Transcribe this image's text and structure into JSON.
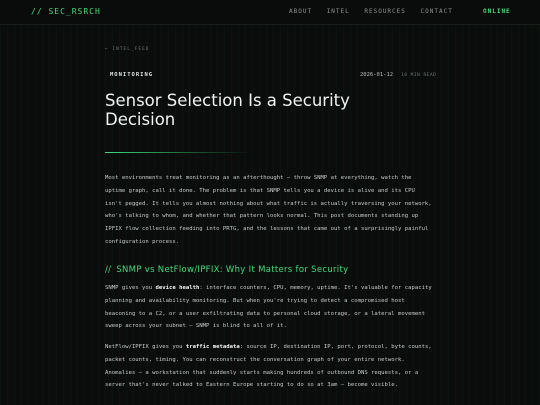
{
  "header": {
    "brand": "// SEC_RSRCH",
    "nav": [
      "ABOUT",
      "INTEL",
      "RESOURCES",
      "CONTACT"
    ],
    "status": "ONLINE"
  },
  "article": {
    "breadcrumb": "← INTEL_FEED",
    "category": "MONITORING",
    "date": "2026-01-12",
    "read_time": "10 MIN READ",
    "title": "Sensor Selection Is a Security Decision",
    "intro": "Most environments treat monitoring as an afterthought — throw SNMP at everything, watch the uptime graph, call it done. The problem is that SNMP tells you a device is alive and its CPU isn't pegged. It tells you almost nothing about what traffic is actually traversing your network, who's talking to whom, and whether that pattern looks normal. This post documents standing up IPFIX flow collection feeding into PRTG, and the lessons that came out of a surprisingly painful configuration process.",
    "section_heading_prefix": "//",
    "section_heading": "SNMP vs NetFlow/IPFIX: Why It Matters for Security",
    "p1_pre": "SNMP gives you ",
    "p1_bold": "device health",
    "p1_post": ": interface counters, CPU, memory, uptime. It's valuable for capacity planning and availability monitoring. But when you're trying to detect a compromised host beaconing to a C2, or a user exfiltrating data to personal cloud storage, or a lateral movement sweep across your subnet — SNMP is blind to all of it.",
    "p2_pre": "NetFlow/IPFIX gives you ",
    "p2_bold": "traffic metadata",
    "p2_post": ": source IP, destination IP, port, protocol, byte counts, packet counts, timing. You can reconstruct the conversation graph of your entire network. Anomalies — a workstation that suddenly starts making hundreds of outbound DNS requests, or a server that's never talked to Eastern Europe starting to do so at 3am — become visible."
  }
}
